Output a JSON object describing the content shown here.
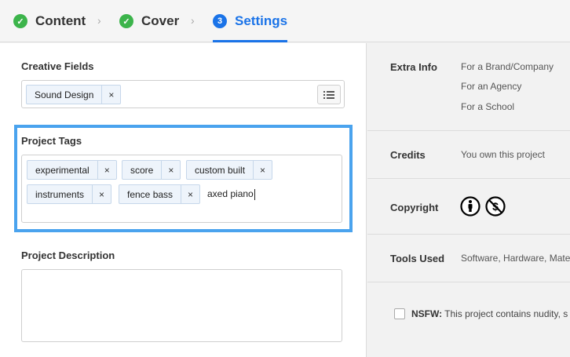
{
  "steps": [
    {
      "label": "Content",
      "state": "done",
      "badge": "✓"
    },
    {
      "label": "Cover",
      "state": "done",
      "badge": "✓"
    },
    {
      "label": "Settings",
      "state": "current",
      "badge": "3"
    }
  ],
  "chevron": "›",
  "creative_fields": {
    "title": "Creative Fields",
    "tags": [
      {
        "label": "Sound Design",
        "remove": "×"
      }
    ],
    "list_icon": "list-icon"
  },
  "project_tags": {
    "title": "Project Tags",
    "tags": [
      {
        "label": "experimental",
        "remove": "×"
      },
      {
        "label": "score",
        "remove": "×"
      },
      {
        "label": "custom built",
        "remove": "×"
      },
      {
        "label": "instruments",
        "remove": "×"
      },
      {
        "label": "fence bass",
        "remove": "×"
      }
    ],
    "input_value": "axed piano"
  },
  "project_description": {
    "title": "Project Description",
    "value": ""
  },
  "right_panel": {
    "extra_info": {
      "label": "Extra Info",
      "options": [
        "For a Brand/Company",
        "For an Agency",
        "For a School"
      ]
    },
    "credits": {
      "label": "Credits",
      "value": "You own this project"
    },
    "copyright": {
      "label": "Copyright",
      "icons": [
        "cc-attribution-icon",
        "cc-noncommercial-icon"
      ]
    },
    "tools_used": {
      "label": "Tools Used",
      "value": "Software, Hardware, Mate"
    },
    "nsfw": {
      "bold": "NSFW:",
      "text": "This project contains nudity, s"
    }
  },
  "colors": {
    "accent": "#1a73e8",
    "done": "#3cb44b",
    "highlight": "#4aa3ee"
  }
}
